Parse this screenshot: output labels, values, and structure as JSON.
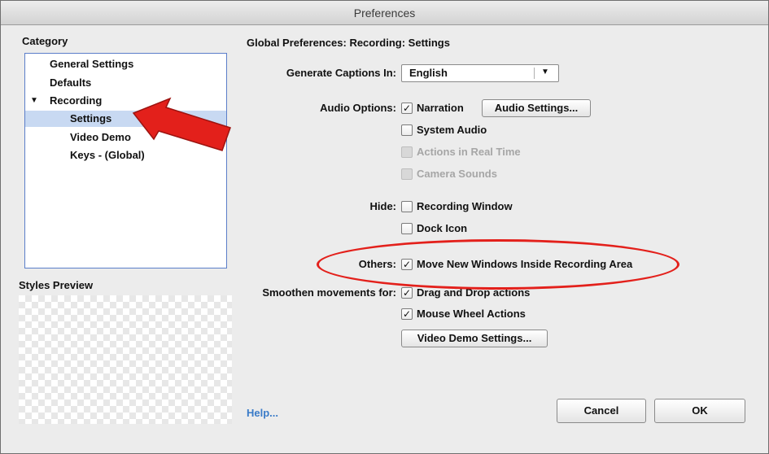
{
  "window": {
    "title": "Preferences"
  },
  "sidebar": {
    "category_label": "Category",
    "items": [
      {
        "label": "General Settings"
      },
      {
        "label": "Defaults"
      },
      {
        "label": "Recording",
        "expander": "▼"
      },
      {
        "label": "Settings"
      },
      {
        "label": "Video Demo"
      },
      {
        "label": "Keys - (Global)"
      }
    ],
    "styles_preview_label": "Styles Preview"
  },
  "main": {
    "heading": "Global Preferences: Recording: Settings",
    "generate_captions": {
      "label": "Generate Captions In:",
      "value": "English",
      "arrow": "▼"
    },
    "audio_options": {
      "label": "Audio Options:",
      "narration": "Narration",
      "audio_settings_button": "Audio Settings...",
      "system_audio": "System Audio",
      "actions_real_time": "Actions in Real Time",
      "camera_sounds": "Camera Sounds"
    },
    "hide": {
      "label": "Hide:",
      "recording_window": "Recording Window",
      "dock_icon": "Dock Icon"
    },
    "others": {
      "label": "Others:",
      "move_windows": "Move New Windows Inside Recording Area"
    },
    "smoothen": {
      "label": "Smoothen movements for:",
      "drag_drop": "Drag and Drop actions",
      "mouse_wheel": "Mouse Wheel Actions",
      "video_demo_settings_button": "Video Demo Settings..."
    },
    "check_mark": "✓"
  },
  "footer": {
    "help": "Help...",
    "cancel": "Cancel",
    "ok": "OK"
  },
  "colors": {
    "annotation": "#e3201b",
    "link": "#3a7bc8",
    "selection": "#c8d9f2"
  }
}
